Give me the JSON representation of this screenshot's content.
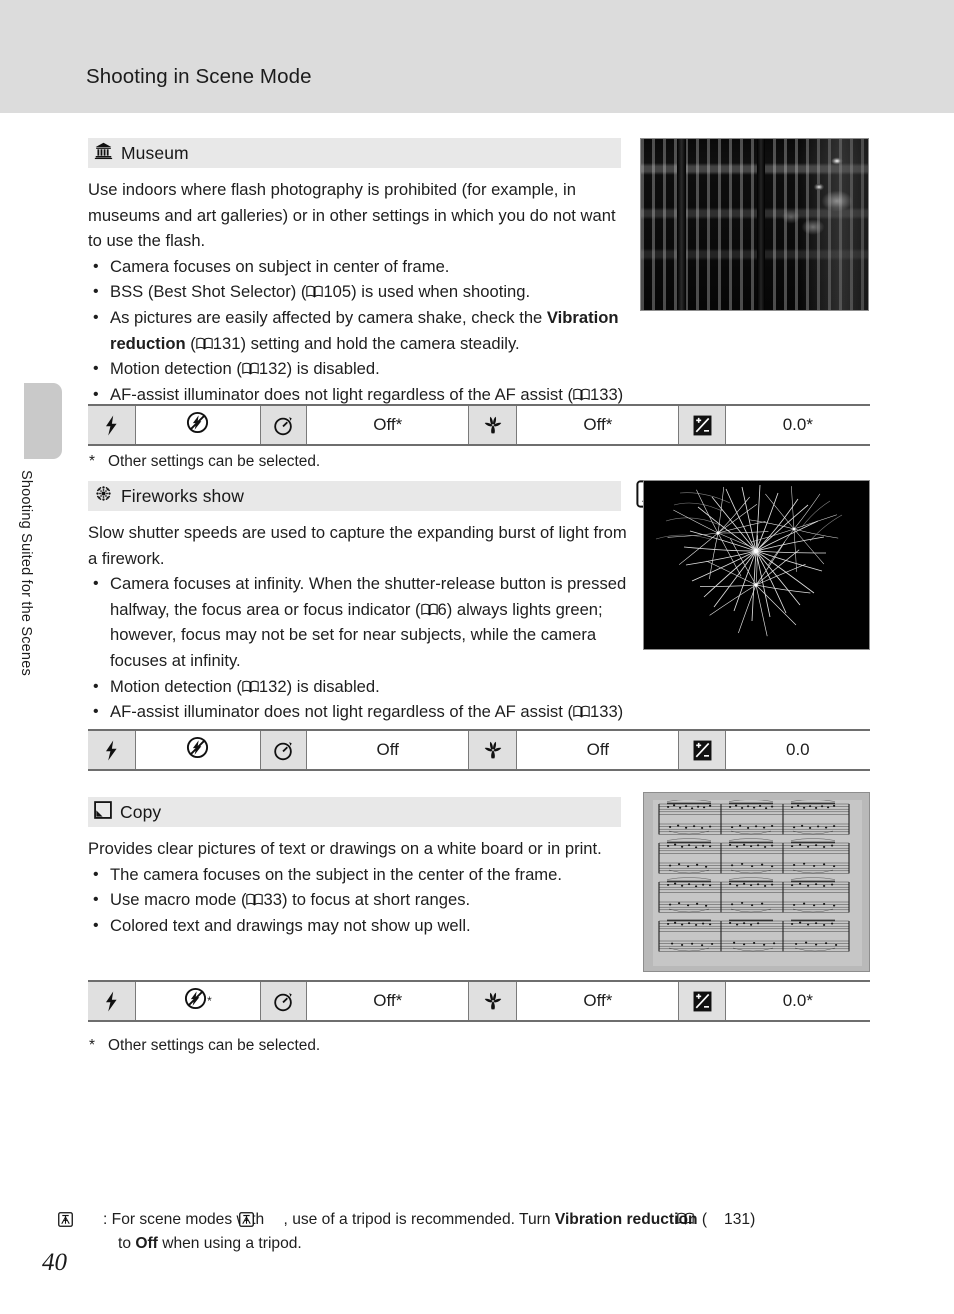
{
  "page": {
    "header_title": "Shooting in Scene Mode",
    "page_number": "40",
    "side_tab_label": "Shooting Suited for the Scenes"
  },
  "sections": [
    {
      "id": "museum",
      "icon": "museum-icon",
      "title": "Museum",
      "has_tripod_badge": false,
      "intro": "Use indoors where flash photography is prohibited (for example, in museums and art galleries) or in other settings in which you do not want to use the flash.",
      "bullets": [
        {
          "pre": "Camera focuses on subject in center of frame.",
          "ref": null,
          "post": ""
        },
        {
          "pre": "BSS (Best Shot Selector) (",
          "ref": "105",
          "post": ") is used when shooting."
        },
        {
          "pre": "As pictures are easily affected by camera shake, check the ",
          "bold": "Vibration reduction",
          "mid": " (",
          "ref": "131",
          "post": ") setting and hold the camera steadily."
        },
        {
          "pre": "Motion detection (",
          "ref": "132",
          "post": ") is disabled."
        },
        {
          "pre": "AF-assist illuminator does not light regardless of the AF assist (",
          "ref": "133",
          "post": ") setting."
        }
      ],
      "photo": "museum-interior-photo",
      "table": {
        "flash_mode_label": "",
        "flash_value_icon": "flash-off-icon",
        "flash_value_star": "",
        "self_timer_value": "Off*",
        "macro_value": "Off*",
        "exposure_value": "0.0*"
      },
      "note": "Other settings can be selected.",
      "note_star": "*"
    },
    {
      "id": "fireworks",
      "icon": "fireworks-icon",
      "title": "Fireworks show",
      "has_tripod_badge": true,
      "intro": "Slow shutter speeds are used to capture the expanding burst of light from a firework.",
      "bullets": [
        {
          "pre": "Camera focuses at infinity. When the shutter-release button is pressed halfway, the focus area or focus indicator (",
          "ref": "6",
          "post": ") always lights green; however, focus may not be set for near subjects, while the camera focuses at infinity."
        },
        {
          "pre": "Motion detection (",
          "ref": "132",
          "post": ") is disabled."
        },
        {
          "pre": "AF-assist illuminator does not light regardless of the AF assist (",
          "ref": "133",
          "post": ") setting."
        }
      ],
      "photo": "fireworks-photo",
      "table": {
        "flash_value_icon": "flash-off-icon",
        "flash_value_star": "",
        "self_timer_value": "Off",
        "macro_value": "Off",
        "exposure_value": "0.0"
      },
      "note": null,
      "note_star": ""
    },
    {
      "id": "copy",
      "icon": "copy-icon",
      "title": "Copy",
      "has_tripod_badge": false,
      "intro": "Provides clear pictures of text or drawings on a white board or in print.",
      "bullets": [
        {
          "pre": "The camera focuses on the subject in the center of the frame.",
          "ref": null,
          "post": ""
        },
        {
          "pre": "Use macro mode (",
          "ref": "33",
          "post": ") to focus at short ranges."
        },
        {
          "pre": "Colored text and drawings may not show up well.",
          "ref": null,
          "post": ""
        }
      ],
      "photo": "sheet-music-photo",
      "table": {
        "flash_value_icon": "flash-off-icon",
        "flash_value_star": "*",
        "self_timer_value": "Off*",
        "macro_value": "Off*",
        "exposure_value": "0.0*"
      },
      "note": "Other settings can be selected.",
      "note_star": "*"
    }
  ],
  "table_icons": {
    "flash_mode": "flash-icon",
    "self_timer": "self-timer-icon",
    "macro": "macro-flower-icon",
    "exposure": "exposure-compensation-icon"
  },
  "bottom_note": {
    "lead_icon": "tripod-icon",
    "part1": ": For scene modes with ",
    "part2": ", use of a tripod is recommended. Turn ",
    "bold": "Vibration reduction",
    "part3": " (",
    "ref": "131",
    "part4": ")",
    "line2_pre": "to ",
    "line2_bold": "Off",
    "line2_post": " when using a tripod."
  },
  "colors": {
    "header_band": "#dcdcdc",
    "scene_head": "#e8e8e8",
    "table_icon_cell": "#e0e0e0",
    "table_rule": "#6e6e6e",
    "side_tab": "#c9c9c9"
  }
}
